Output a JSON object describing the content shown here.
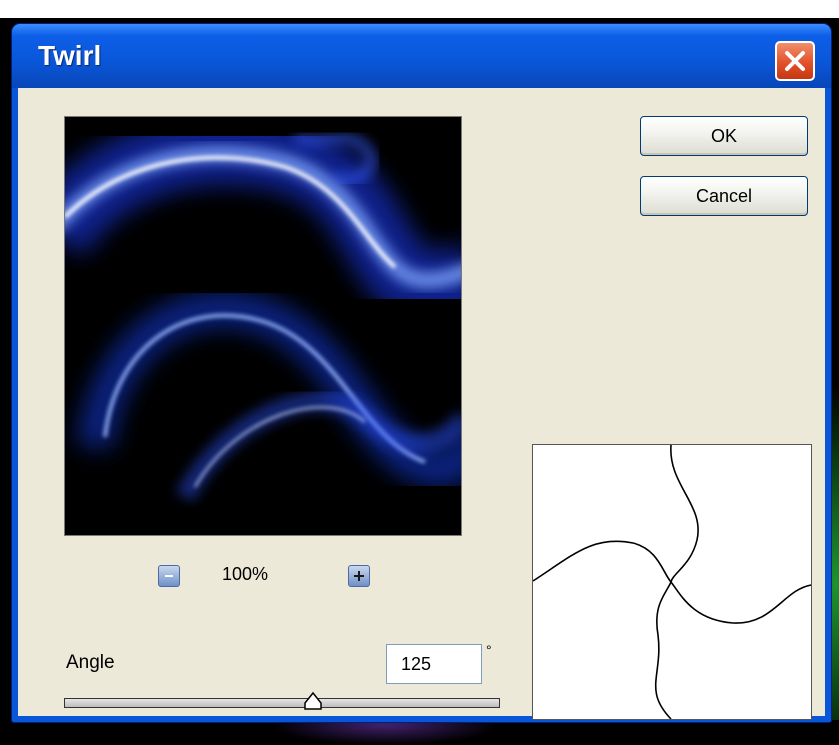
{
  "window": {
    "title": "Twirl"
  },
  "buttons": {
    "ok": "OK",
    "cancel": "Cancel"
  },
  "zoom": {
    "value": "100%",
    "minus_icon": "minus-icon",
    "plus_icon": "plus-icon"
  },
  "angle": {
    "label": "Angle",
    "value": "125",
    "unit": "°",
    "slider_fraction": 0.57
  },
  "colors": {
    "titlebar": "#0a56d8",
    "client": "#ece9d8",
    "close": "#e2512a"
  }
}
